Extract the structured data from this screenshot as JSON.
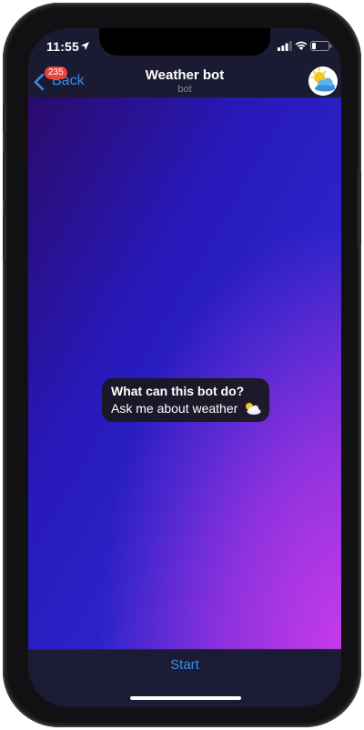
{
  "status_bar": {
    "time": "11:55"
  },
  "nav": {
    "back_label": "Back",
    "unread_count": "235",
    "title": "Weather bot",
    "subtitle": "bot",
    "avatar_icon": "sun-cloud-icon"
  },
  "info_card": {
    "title": "What can this bot do?",
    "description": "Ask me about weather",
    "emoji_icon": "sun-behind-cloud-icon"
  },
  "bottom": {
    "start_label": "Start"
  },
  "colors": {
    "accent": "#3a8de6",
    "badge": "#e8453d",
    "nav_background": "#1b1a33"
  }
}
